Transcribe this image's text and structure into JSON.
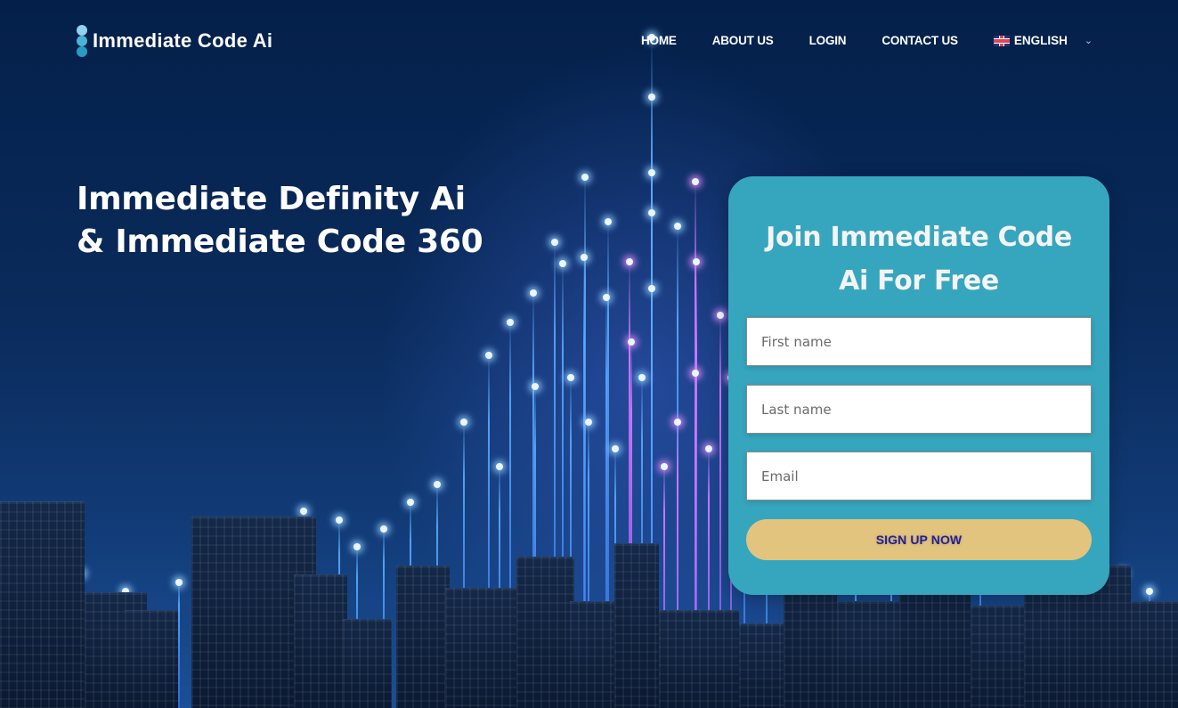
{
  "header": {
    "logo_text": "Immediate Code Ai",
    "nav": [
      {
        "label": "HOME"
      },
      {
        "label": "ABOUT US"
      },
      {
        "label": "LOGIN"
      },
      {
        "label": "CONTACT US"
      }
    ],
    "language": {
      "label": "ENGLISH",
      "flag_icon": "uk-flag-icon",
      "chevron_icon": "chevron-down-icon"
    }
  },
  "hero": {
    "headline_line1": "Immediate Definity Ai",
    "headline_line2": "& Immediate Code 360"
  },
  "signup_form": {
    "title_line1": "Join Immediate Code",
    "title_line2": "Ai For Free",
    "first_name": {
      "value": "",
      "placeholder": "First name"
    },
    "last_name": {
      "value": "",
      "placeholder": "Last name"
    },
    "email": {
      "value": "",
      "placeholder": "Email"
    },
    "submit_label": "SIGN UP NOW"
  },
  "colors": {
    "background": "#0a2350",
    "card": "#36a6be",
    "button": "#e2c47e",
    "button_text": "#1f1f9c"
  }
}
